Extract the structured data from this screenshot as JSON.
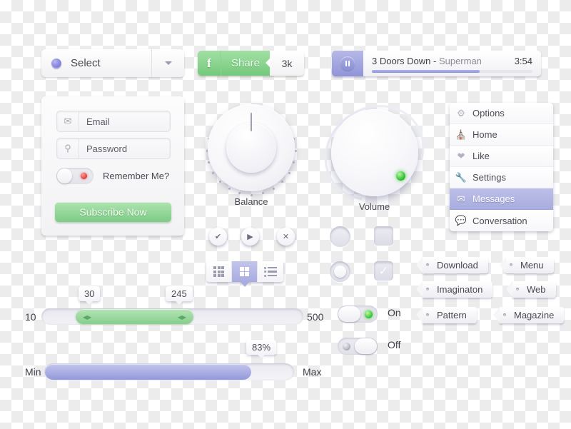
{
  "select_dropdown": {
    "label": "Select",
    "icon": "bullet-sphere-icon",
    "caret": "chevron-down-icon"
  },
  "share_button": {
    "brand_icon": "facebook-f-icon",
    "label": "Share",
    "count": "3k"
  },
  "player": {
    "control_icon": "pause-icon",
    "artist": "3 Doors Down",
    "separator": " - ",
    "track": "Superman",
    "time": "3:54",
    "progress_percent": 67
  },
  "login": {
    "email": {
      "icon": "envelope-icon",
      "placeholder": "Email",
      "value": "Email"
    },
    "password": {
      "icon": "key-icon",
      "placeholder": "Password",
      "value": "Password"
    },
    "remember": {
      "label": "Remember Me?",
      "state": "off",
      "led_color": "#e03a3a"
    },
    "subscribe_label": "Subscribe Now",
    "subscribe_color": "#7ecb86"
  },
  "knobs": [
    {
      "name": "balance",
      "label": "Balance",
      "value_angle_deg": 0
    },
    {
      "name": "volume",
      "label": "Volume",
      "led_color": "#2fbe2f"
    }
  ],
  "menu": {
    "items": [
      {
        "label": "Options",
        "icon": "gear-icon",
        "selected": false
      },
      {
        "label": "Home",
        "icon": "home-icon",
        "selected": false
      },
      {
        "label": "Like",
        "icon": "heart-icon",
        "selected": false
      },
      {
        "label": "Settings",
        "icon": "wrench-icon",
        "selected": false
      },
      {
        "label": "Messages",
        "icon": "envelope-icon",
        "selected": true
      },
      {
        "label": "Conversation",
        "icon": "speech-bubble-icon",
        "selected": false
      }
    ],
    "selected_color": "#a9ade0"
  },
  "round_buttons": [
    {
      "name": "confirm",
      "icon": "check-icon",
      "glyph": "✔"
    },
    {
      "name": "play",
      "icon": "play-icon",
      "glyph": "▶"
    },
    {
      "name": "close",
      "icon": "close-icon",
      "glyph": "✕"
    }
  ],
  "segmented": {
    "options": [
      {
        "name": "grid-view",
        "icon": "grid-9-icon",
        "selected": false
      },
      {
        "name": "tile-view",
        "icon": "grid-4-icon",
        "selected": true
      },
      {
        "name": "list-view",
        "icon": "list-icon",
        "selected": false
      }
    ]
  },
  "selection_controls": {
    "radio_unselected": "radio-off-icon",
    "radio_selected": "radio-on-icon",
    "checkbox_unchecked": "checkbox-off-icon",
    "checkbox_checked": "checkbox-on-icon",
    "check_glyph": "✓"
  },
  "tags": [
    {
      "label": "Download"
    },
    {
      "label": "Menu"
    },
    {
      "label": "Imaginaton"
    },
    {
      "label": "Web"
    },
    {
      "label": "Pattern"
    },
    {
      "label": "Magazine"
    }
  ],
  "range_slider": {
    "min_label": "10",
    "max_label": "500",
    "lower_value": "30",
    "upper_value": "245",
    "fill_color": "#86cf8c"
  },
  "progress_slider": {
    "min_label": "Min",
    "max_label": "Max",
    "value_label": "83%",
    "percent": 83,
    "fill_color": "#9398da"
  },
  "toggles": [
    {
      "label": "On",
      "state": "on",
      "led_color": "#30c030"
    },
    {
      "label": "Off",
      "state": "off",
      "led_color": "#a9a9ba"
    }
  ]
}
